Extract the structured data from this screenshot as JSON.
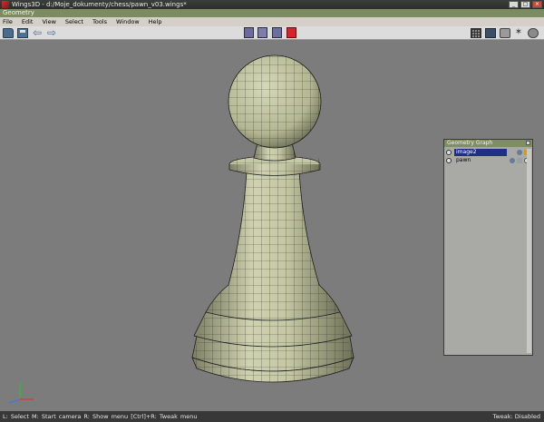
{
  "window": {
    "title": "Wings3D - d:/Moje_dokumenty/chess/pawn_v03.wings*"
  },
  "geometry_bar": {
    "title": "Geometry"
  },
  "menu": {
    "items": [
      "File",
      "Edit",
      "View",
      "Select",
      "Tools",
      "Window",
      "Help"
    ]
  },
  "toolbar": {
    "left_icons": [
      "folder-icon",
      "save-icon",
      "undo-arrow-icon",
      "redo-arrow-icon"
    ],
    "selection_modes": [
      "vertex",
      "edge",
      "face",
      "body"
    ],
    "active_selection_mode": "body",
    "active_color": "#d8232a",
    "right_icons": [
      "grid-icon",
      "cube-icon",
      "smooth-icon",
      "perspective-icon",
      "ortho-icon"
    ]
  },
  "geometry_graph": {
    "title": "Geometry Graph",
    "items": [
      {
        "name": "image2",
        "selected": true
      },
      {
        "name": "pawn",
        "selected": false
      }
    ]
  },
  "status": {
    "hints": "L: Select   M: Start camera   R: Show menu   [Ctrl]+R: Tweak menu",
    "tweak": "Tweak: Disabled"
  },
  "colors": {
    "background": "#7c7c7c",
    "mesh_fill": "#c8cba8",
    "mesh_lines": "#1e1e1e",
    "title_green": "#7d8b63"
  }
}
